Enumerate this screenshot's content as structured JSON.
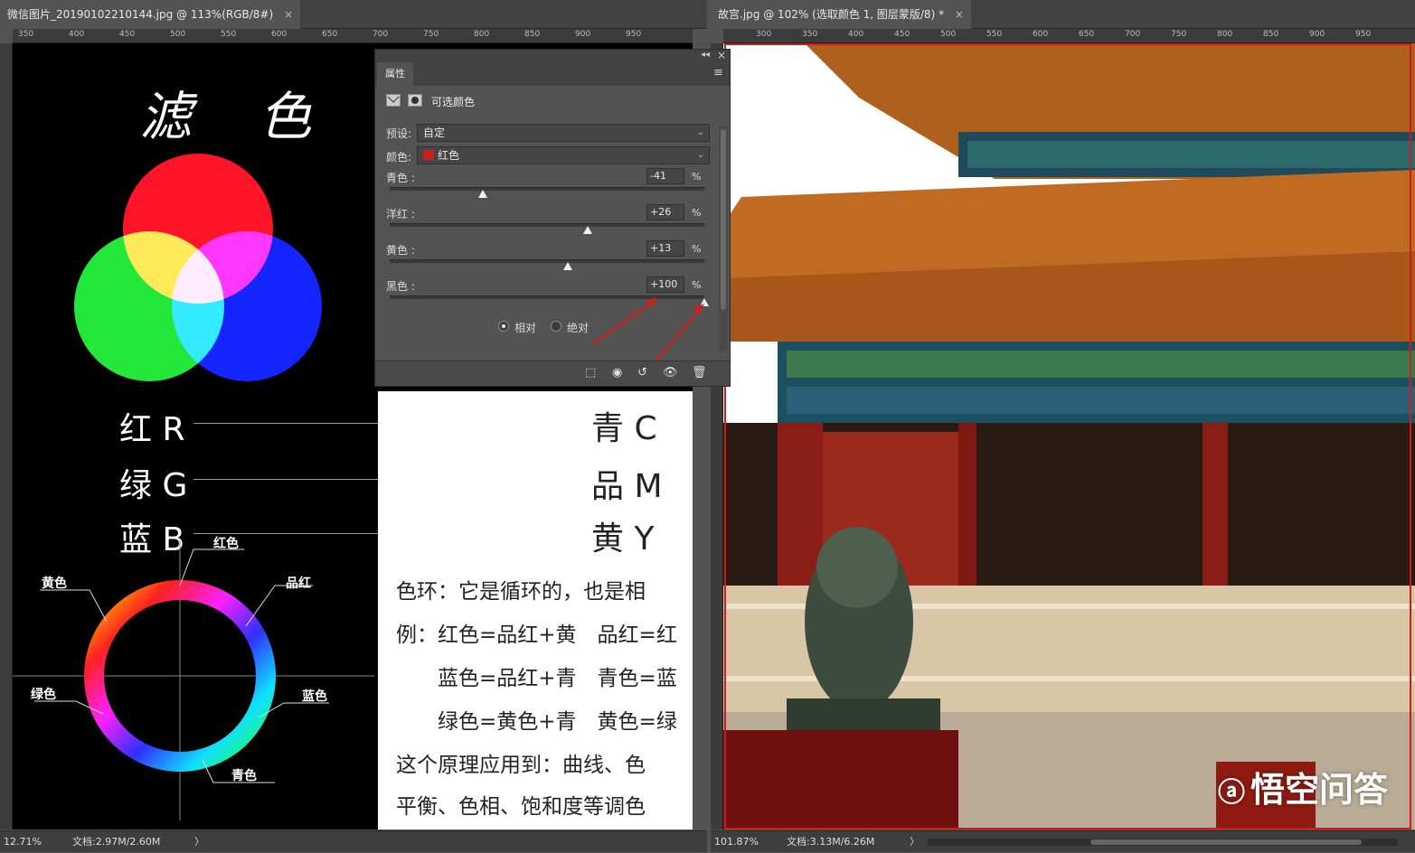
{
  "left_doc": {
    "tab_title": "微信图片_20190102210144.jpg @ 113%(RGB/8#)",
    "tab_close": "×",
    "ruler_ticks": [
      "350",
      "400",
      "450",
      "500",
      "550",
      "600",
      "650",
      "700",
      "750",
      "800",
      "850",
      "900",
      "950"
    ],
    "zoom": "12.71%",
    "doc_size": "文档:2.97M/2.60M",
    "status_arrow": "〉"
  },
  "right_doc": {
    "tab_title": "故宫.jpg @ 102% (选取颜色 1, 图层蒙版/8) *",
    "tab_close": "×",
    "ruler_ticks": [
      "300",
      "350",
      "400",
      "450",
      "500",
      "550",
      "600",
      "650",
      "700",
      "750",
      "800",
      "850",
      "900",
      "950"
    ],
    "zoom": "101.87%",
    "doc_size": "文档:3.13M/6.26M",
    "status_arrow": "〉"
  },
  "left_image": {
    "title": "滤 色",
    "rgb": [
      "红 R",
      "绿 G",
      "蓝 B"
    ],
    "cmy": [
      "青 C",
      "品 M",
      "黄 Y"
    ],
    "wheel_labels": {
      "red": "红色",
      "magenta": "品红",
      "yellow": "黄色",
      "green": "绿色",
      "blue": "蓝色",
      "cyan": "青色"
    },
    "paragraph": [
      "色环：它是循环的，也是相",
      "例：红色=品红+黄　品红=红",
      "　　蓝色=品红+青　青色=蓝",
      "　　绿色=黄色+青　黄色=绿",
      "这个原理应用到：曲线、色",
      "平衡、色相、饱和度等调色"
    ]
  },
  "properties_panel": {
    "tab_label": "属性",
    "title": "可选颜色",
    "preset_label": "预设:",
    "preset_value": "自定",
    "colors_label": "颜色:",
    "colors_value": "红色",
    "color_swatch": "#c8201a",
    "sliders": [
      {
        "label": "青色 :",
        "value": "-41",
        "unit": "%",
        "level": -41
      },
      {
        "label": "洋红 :",
        "value": "+26",
        "unit": "%",
        "level": 26
      },
      {
        "label": "黄色 :",
        "value": "+13",
        "unit": "%",
        "level": 13
      },
      {
        "label": "黑色 :",
        "value": "+100",
        "unit": "%",
        "level": 100
      }
    ],
    "method_relative": "相对",
    "method_absolute": "绝对",
    "collapse_icon": "◂◂",
    "close_icon": "×",
    "menu_icon": "≡"
  },
  "watermark": "悟空问答",
  "colors": {
    "accent_red": "#d11a1a",
    "panel_bg": "#535353",
    "chrome_dark": "#424242"
  }
}
